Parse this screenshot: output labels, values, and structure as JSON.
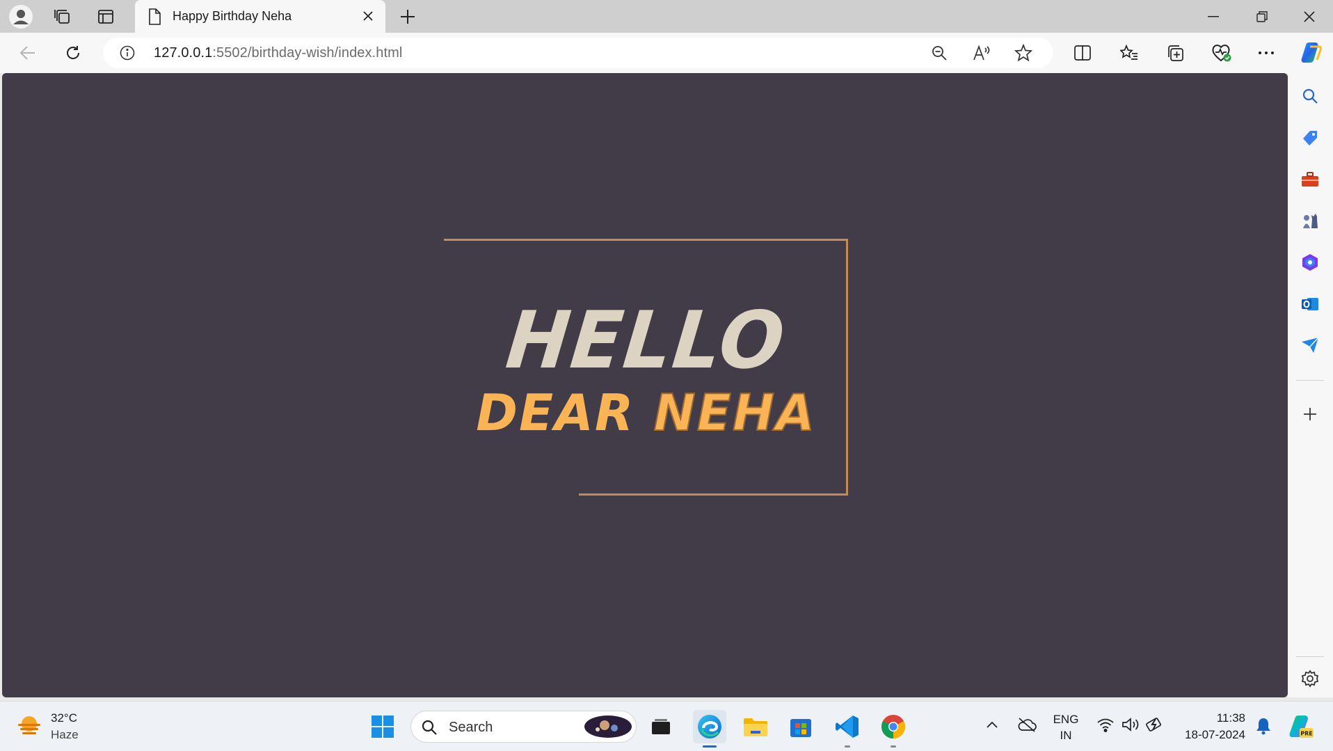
{
  "browser": {
    "tab_title": "Happy Birthday Neha",
    "url_host": "127.0.0.1",
    "url_rest": ":5502/birthday-wish/index.html"
  },
  "page": {
    "hello": "HELLO",
    "dear": "DEAR ",
    "name": "NEHA",
    "colors": {
      "background": "#423c49",
      "frame": "#c58b55",
      "hello": "#dcd3c3",
      "dear": "#fbb455"
    }
  },
  "taskbar": {
    "temperature": "32°C",
    "weather": "Haze",
    "search_placeholder": "Search",
    "language": "ENG",
    "region": "IN",
    "time": "11:38",
    "date": "18-07-2024"
  },
  "icons": {
    "sidebar": [
      "search-icon",
      "tag-icon",
      "toolbox-icon",
      "chess-icon",
      "office-icon",
      "outlook-icon",
      "send-icon",
      "add-icon",
      "settings-icon"
    ]
  }
}
